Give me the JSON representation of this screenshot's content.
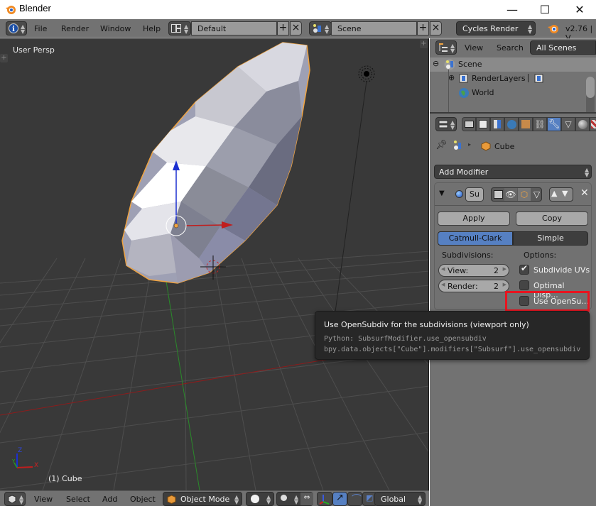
{
  "window": {
    "title": "Blender",
    "controls": {
      "minimize": "—",
      "maximize": "☐",
      "close": "✕"
    }
  },
  "info_header": {
    "editor_type_icon": "info-icon",
    "menus": [
      "File",
      "Render",
      "Window",
      "Help"
    ],
    "screen_layout": "Default",
    "scene": "Scene",
    "render_engine": "Cycles Render",
    "version": "v2.76 | V"
  },
  "viewport": {
    "view_label": "User Persp",
    "active_object_label": "(1) Cube",
    "axis_labels": {
      "x": "X",
      "y": "Y",
      "z": "Z"
    },
    "colors": {
      "background": "#393939",
      "selection_outline": "#f0a340",
      "x_axis": "#c01e1e",
      "y_axis": "#22a022",
      "z_axis": "#1b2fd0"
    }
  },
  "view_header": {
    "menus": [
      "View",
      "Select",
      "Add",
      "Object"
    ],
    "mode": "Object Mode",
    "transform_orientation": "Global"
  },
  "outliner": {
    "header": {
      "menus": [
        "View",
        "Search"
      ],
      "display_mode": "All Scenes"
    },
    "items": [
      {
        "label": "Scene",
        "expand": "⊖",
        "icon": "scene-icon"
      },
      {
        "label": "RenderLayers",
        "expand": "⊕",
        "icon": "render-layers-icon"
      },
      {
        "label": "World",
        "expand": "",
        "icon": "world-icon"
      }
    ]
  },
  "properties": {
    "tabs": [
      "render",
      "render-layers",
      "scene",
      "world",
      "object",
      "constraints",
      "modifiers",
      "data",
      "material",
      "texture"
    ],
    "active_tab": "modifiers",
    "breadcrumb": {
      "object": "Cube"
    },
    "add_modifier_label": "Add Modifier",
    "modifier": {
      "name": "Su",
      "apply_label": "Apply",
      "copy_label": "Copy",
      "subdivision_types": [
        "Catmull-Clark",
        "Simple"
      ],
      "selected_type": "Catmull-Clark",
      "subdivisions_label": "Subdivisions:",
      "options_label": "Options:",
      "view": {
        "label": "View:",
        "value": "2"
      },
      "render": {
        "label": "Render:",
        "value": "2"
      },
      "options": [
        {
          "label": "Subdivide UVs",
          "checked": true
        },
        {
          "label": "Optimal Disp...",
          "checked": false
        },
        {
          "label": "Use OpenSu...",
          "checked": false
        }
      ]
    },
    "accent_color": "#5680c2",
    "highlight_color": "#e8141f"
  },
  "tooltip": {
    "title": "Use OpenSubdiv for the subdivisions (viewport only)",
    "python": "Python: SubsurfModifier.use_opensubdiv",
    "path": "bpy.data.objects[\"Cube\"].modifiers[\"Subsurf\"].use_opensubdiv"
  }
}
